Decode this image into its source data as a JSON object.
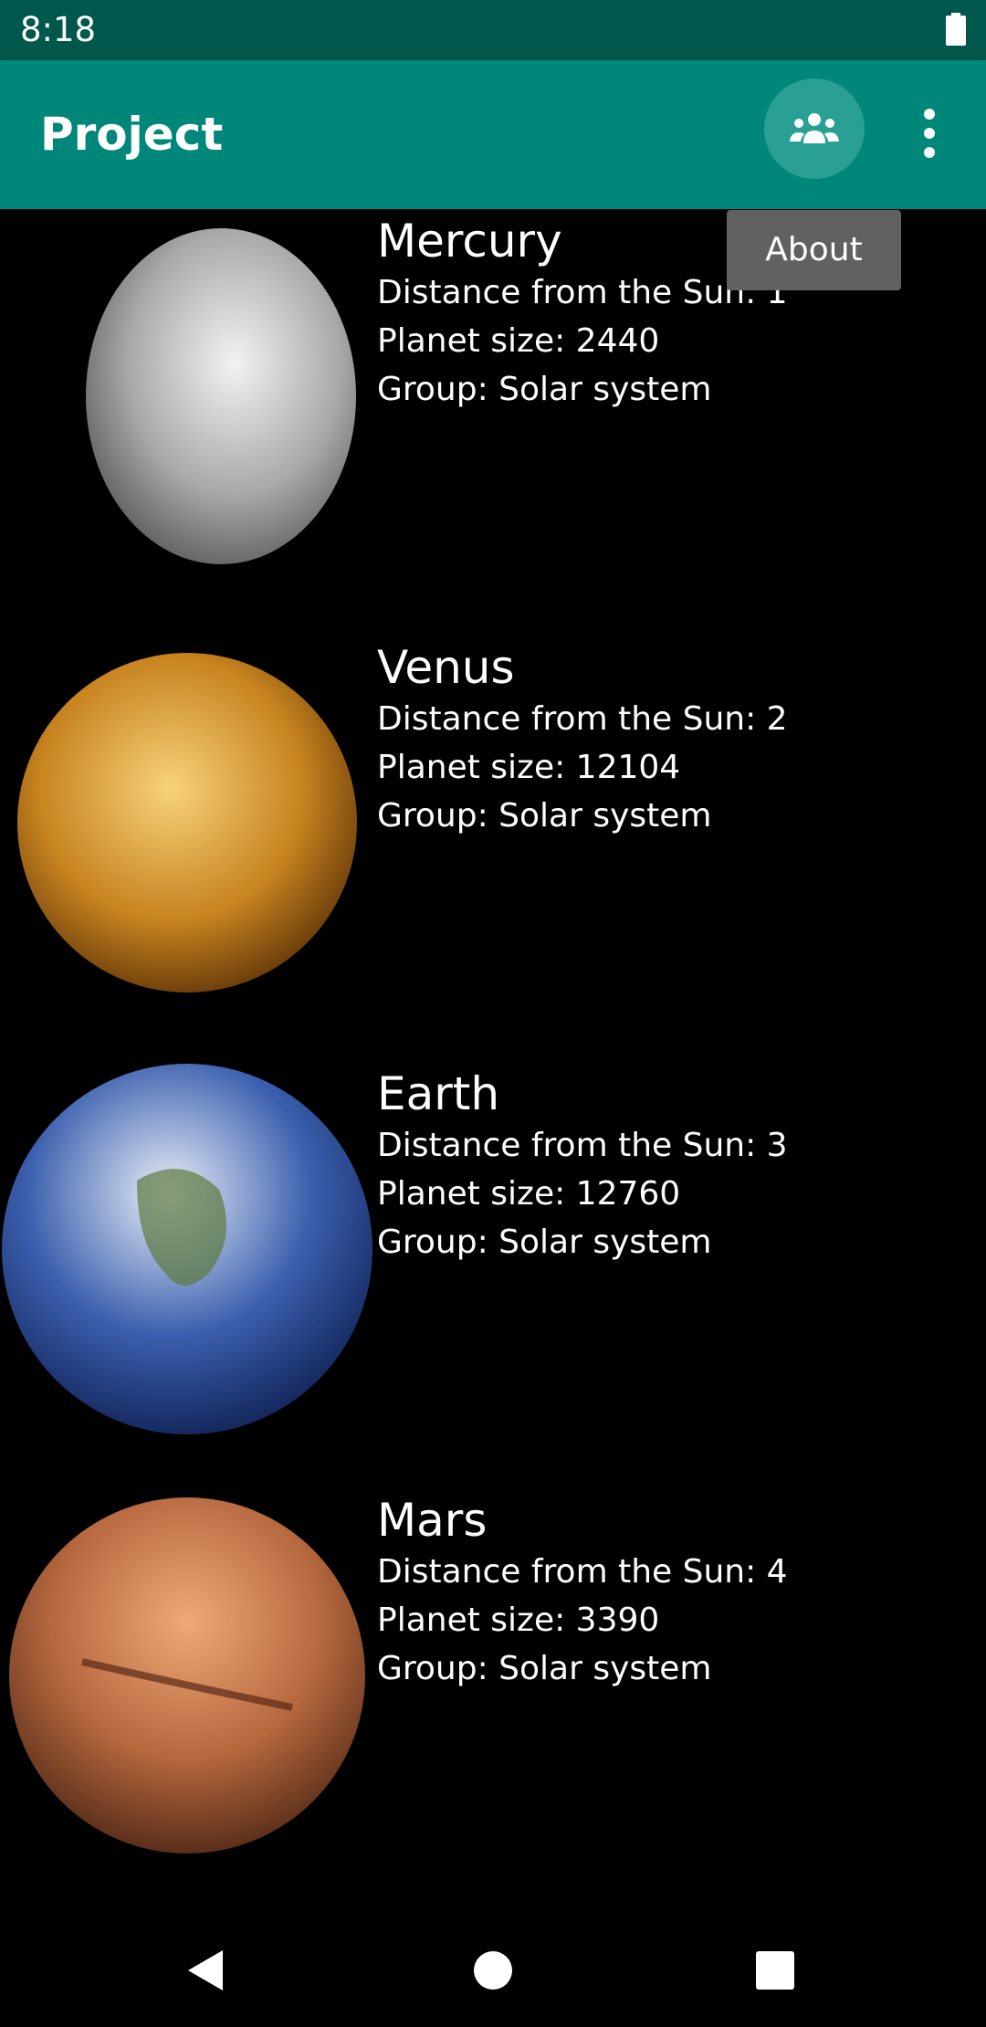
{
  "status_bar": {
    "time": "8:18",
    "battery_icon": "battery-full-icon"
  },
  "app_bar": {
    "title": "Project",
    "action_icon": "group-icon",
    "overflow_icon": "more-vert-icon",
    "colors": {
      "status": "#00574b",
      "toolbar": "#00877a",
      "action_circle": "#2aa094"
    }
  },
  "tooltip": {
    "label": "About"
  },
  "planets": [
    {
      "name": "Mercury",
      "distance": "Distance from the Sun: 1",
      "size": "Planet size: 2440",
      "group": "Group: Solar system",
      "colors": [
        "#f2f2f2",
        "#a9a9a9",
        "#5a5a5a"
      ]
    },
    {
      "name": "Venus",
      "distance": "Distance from the Sun: 2",
      "size": "Planet size: 12104",
      "group": "Group: Solar system",
      "colors": [
        "#f7d27a",
        "#c7831f",
        "#5e3308"
      ]
    },
    {
      "name": "Earth",
      "distance": "Distance from the Sun: 3",
      "size": "Planet size: 12760",
      "group": "Group: Solar system",
      "colors": [
        "#e9eef7",
        "#3b5fae",
        "#0f1f52"
      ]
    },
    {
      "name": "Mars",
      "distance": "Distance from the Sun: 4",
      "size": "Planet size: 3390",
      "group": "Group: Solar system",
      "colors": [
        "#f0a878",
        "#b5673d",
        "#4a2414"
      ]
    }
  ],
  "nav": {
    "back_icon": "back-icon",
    "home_icon": "home-icon",
    "recents_icon": "recents-icon"
  }
}
